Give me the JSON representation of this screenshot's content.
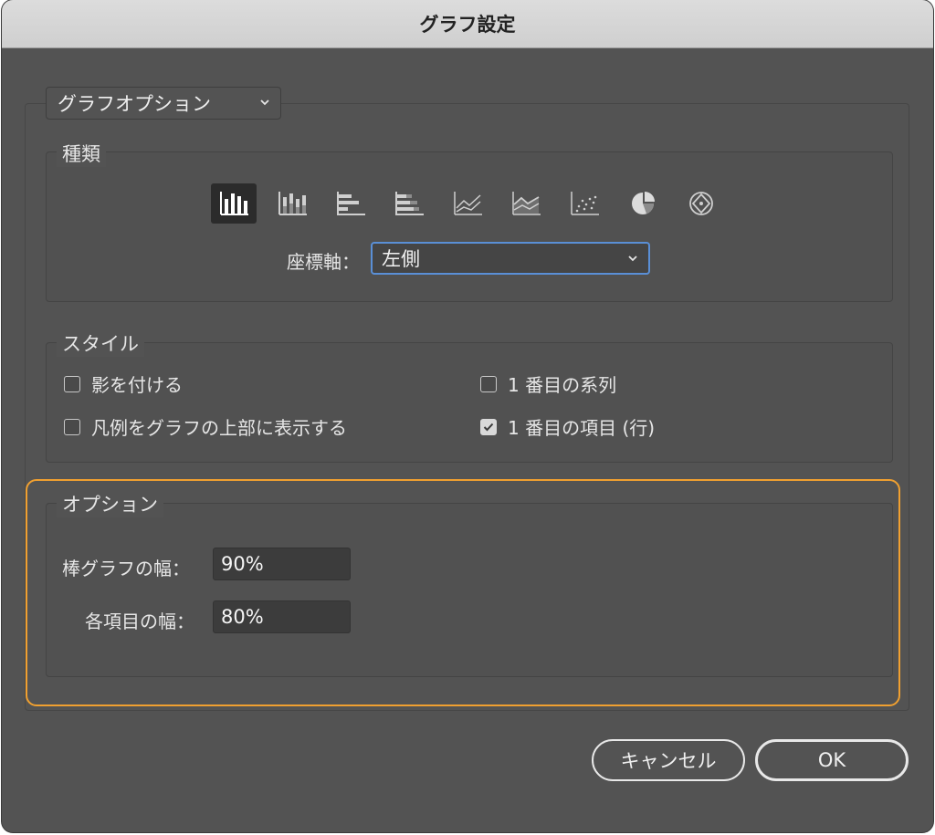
{
  "window": {
    "title": "グラフ設定"
  },
  "section_dropdown": {
    "value": "グラフオプション"
  },
  "type_group": {
    "label": "種類",
    "icons": [
      {
        "name": "column-chart-icon",
        "selected": true
      },
      {
        "name": "stacked-column-chart-icon",
        "selected": false
      },
      {
        "name": "bar-chart-icon",
        "selected": false
      },
      {
        "name": "stacked-bar-chart-icon",
        "selected": false
      },
      {
        "name": "line-chart-icon",
        "selected": false
      },
      {
        "name": "area-chart-icon",
        "selected": false
      },
      {
        "name": "scatter-chart-icon",
        "selected": false
      },
      {
        "name": "pie-chart-icon",
        "selected": false
      },
      {
        "name": "radar-chart-icon",
        "selected": false
      }
    ],
    "axis_label": "座標軸：",
    "axis_value": "左側"
  },
  "style_group": {
    "label": "スタイル",
    "checkboxes": [
      {
        "label": "影を付ける",
        "checked": false
      },
      {
        "label": "凡例をグラフの上部に表示する",
        "checked": false
      },
      {
        "label": "1 番目の系列",
        "checked": false
      },
      {
        "label": "1 番目の項目 (行)",
        "checked": true
      }
    ]
  },
  "options_group": {
    "label": "オプション",
    "bar_width_label": "棒グラフの幅：",
    "bar_width_value": "90%",
    "item_width_label": "各項目の幅：",
    "item_width_value": "80%"
  },
  "buttons": {
    "cancel": "キャンセル",
    "ok": "OK"
  },
  "colors": {
    "highlight": "#f0a030",
    "focus": "#5a8fd6",
    "panel": "#535353"
  }
}
